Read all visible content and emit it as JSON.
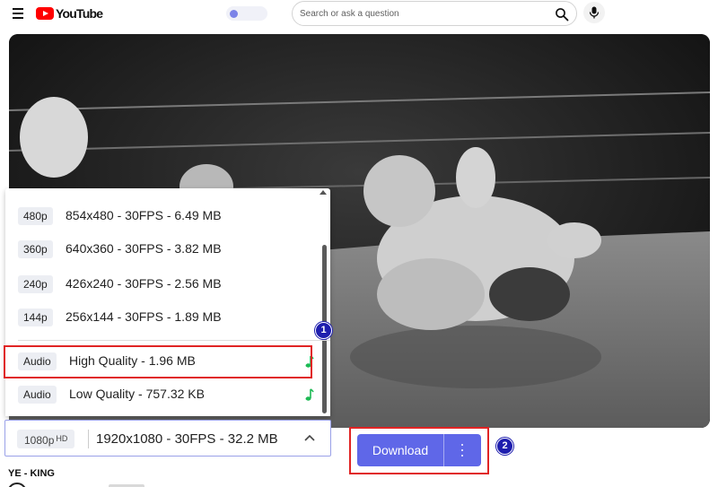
{
  "header": {
    "logo_text": "YouTube",
    "search_placeholder": "Search or ask a question",
    "menu_icon": "hamburger-menu-icon",
    "search_icon": "magnifier-icon",
    "mic_icon": "microphone-icon"
  },
  "quality_options": [
    {
      "badge": "480p",
      "label": "854x480 - 30FPS - 6.49 MB"
    },
    {
      "badge": "360p",
      "label": "640x360 - 30FPS - 3.82 MB"
    },
    {
      "badge": "240p",
      "label": "426x240 - 30FPS - 2.56 MB"
    },
    {
      "badge": "144p",
      "label": "256x144 - 30FPS - 1.89 MB"
    }
  ],
  "audio_options": [
    {
      "badge": "Audio",
      "label": "High Quality - 1.96 MB",
      "icon": "music-note-icon"
    },
    {
      "badge": "Audio",
      "label": "Low Quality - 757.32 KB",
      "icon": "music-note-icon"
    }
  ],
  "selected_quality": {
    "badge": "1080p",
    "badge_suffix": "HD",
    "label": "1920x1080 - 30FPS - 32.2 MB"
  },
  "download": {
    "label": "Download",
    "more_icon": "vertical-dots-icon"
  },
  "annotations": {
    "step1": "1",
    "step2": "2"
  },
  "video": {
    "title": "YE - KING"
  },
  "colors": {
    "accent": "#5f67e8",
    "highlight": "#e02424",
    "note": "#1db954",
    "step_badge": "#1e1eae"
  }
}
